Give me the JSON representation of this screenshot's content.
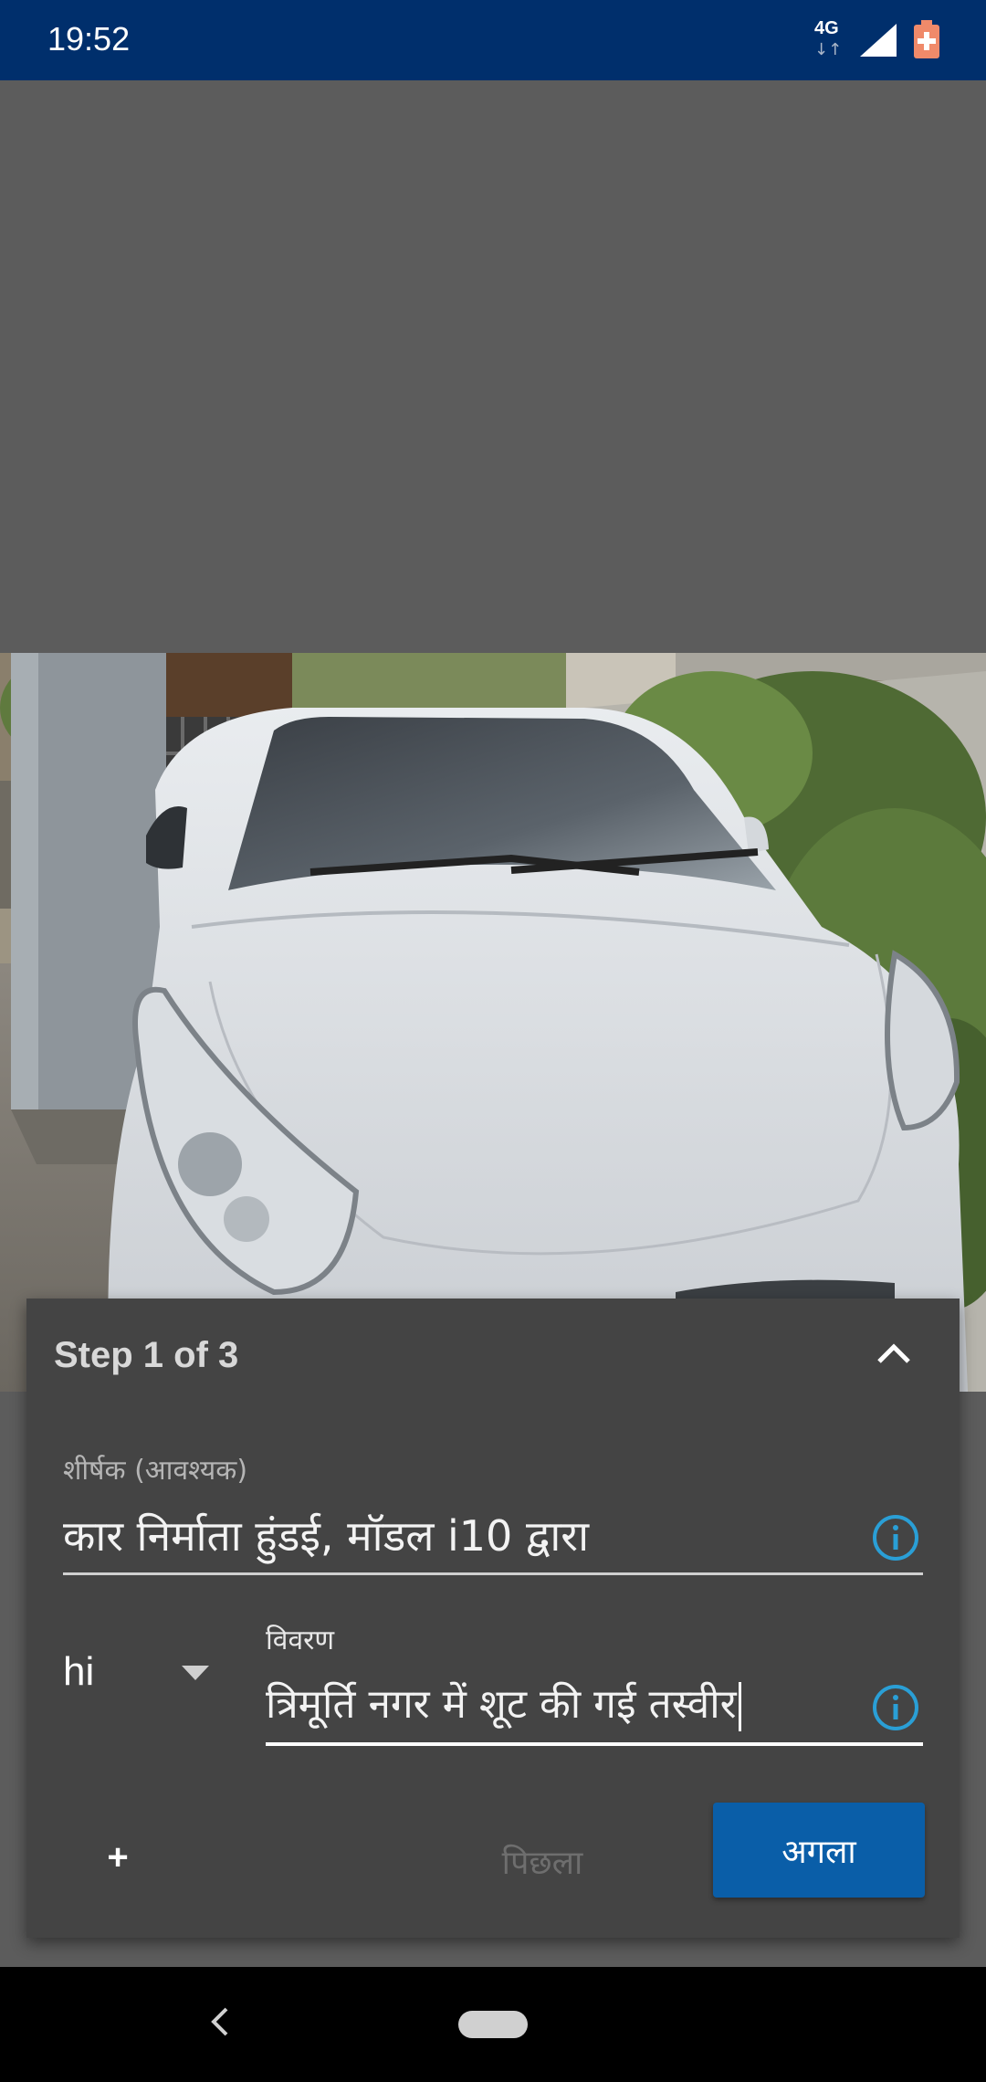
{
  "status_bar": {
    "time": "19:52",
    "network": "4G",
    "network_arrows": "↓↑",
    "signal_icon": "signal-full-icon",
    "battery_icon": "battery-saver-icon"
  },
  "photo": {
    "description_icon": "car-photo"
  },
  "wizard": {
    "step_label": "Step 1 of 3",
    "collapse_icon": "chevron-up-icon",
    "title_field": {
      "label": "शीर्षक (आवश्यक)",
      "value": "कार निर्माता हुंडई, मॉडल i10 द्वारा",
      "info_icon": "info-icon"
    },
    "language": {
      "value": "hi",
      "dropdown_icon": "dropdown-arrow-icon"
    },
    "description_field": {
      "label": "विवरण",
      "value": "त्रिमूर्ति नगर में शूट की गई तस्वीर",
      "info_icon": "info-icon"
    },
    "add_label": "+",
    "previous_label": "पिछला",
    "next_label": "अगला"
  },
  "nav_bar": {
    "back_icon": "back-icon",
    "home_icon": "home-pill-icon"
  },
  "colors": {
    "status_bar": "#002f6c",
    "panel": "#444444",
    "primary_button": "#0a5ea8",
    "info_icon": "#2a9fd6"
  }
}
